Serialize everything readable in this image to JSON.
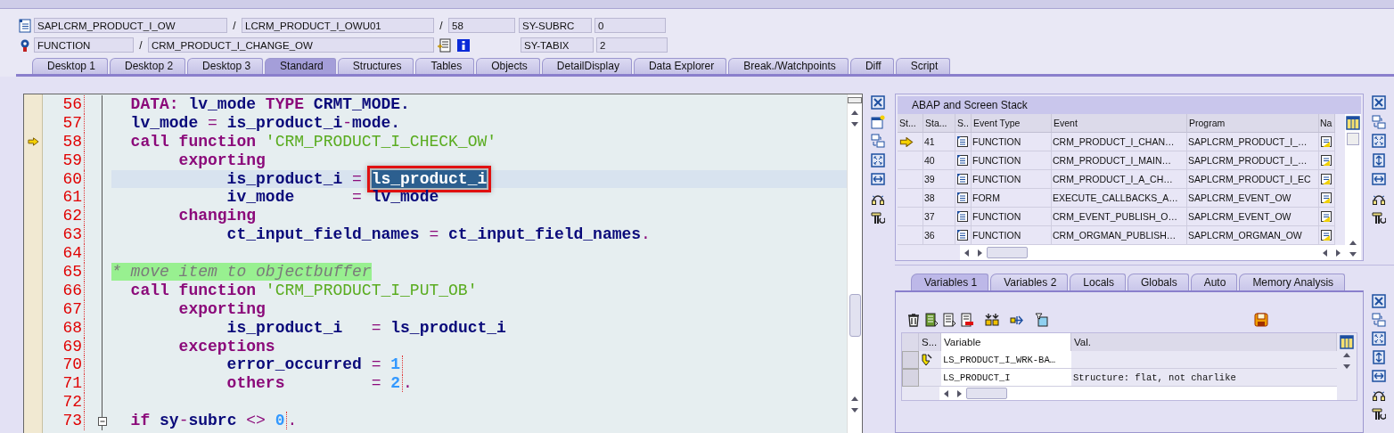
{
  "header": {
    "program": "SAPLCRM_PRODUCT_I_OW",
    "include": "LCRM_PRODUCT_I_OWU01",
    "line": "58",
    "separators": [
      "/",
      "/",
      "/"
    ],
    "event_type": "FUNCTION",
    "event": "CRM_PRODUCT_I_CHANGE_OW",
    "system_fields": [
      {
        "name": "SY-SUBRC",
        "value": "0"
      },
      {
        "name": "SY-TABIX",
        "value": "2"
      }
    ]
  },
  "tabs": [
    {
      "label": "Desktop 1",
      "selected": false
    },
    {
      "label": "Desktop 2",
      "selected": false
    },
    {
      "label": "Desktop 3",
      "selected": false
    },
    {
      "label": "Standard",
      "selected": true
    },
    {
      "label": "Structures",
      "selected": false
    },
    {
      "label": "Tables",
      "selected": false
    },
    {
      "label": "Objects",
      "selected": false
    },
    {
      "label": "DetailDisplay",
      "selected": false
    },
    {
      "label": "Data Explorer",
      "selected": false
    },
    {
      "label": "Break./Watchpoints",
      "selected": false
    },
    {
      "label": "Diff",
      "selected": false
    },
    {
      "label": "Script",
      "selected": false
    }
  ],
  "editor": {
    "lines": [
      {
        "number": "56",
        "current": false,
        "highlighted": false,
        "foldable": false,
        "tokens": [
          {
            "kind": "keyword",
            "text": "  DATA:"
          },
          {
            "kind": "identifier",
            "text": " lv_mode"
          },
          {
            "kind": "keyword",
            "text": " TYPE"
          },
          {
            "kind": "identifier",
            "text": " CRMT_MODE."
          }
        ]
      },
      {
        "number": "57",
        "current": false,
        "highlighted": false,
        "foldable": false,
        "tokens": [
          {
            "kind": "identifier",
            "text": "  lv_mode"
          },
          {
            "kind": "operator",
            "text": " ="
          },
          {
            "kind": "identifier",
            "text": " is_product_i"
          },
          {
            "kind": "operator",
            "text": "-"
          },
          {
            "kind": "identifier",
            "text": "mode."
          }
        ]
      },
      {
        "number": "58",
        "current": true,
        "highlighted": false,
        "foldable": false,
        "tokens": [
          {
            "kind": "keyword",
            "text": "  call function"
          },
          {
            "kind": "string",
            "text": " 'CRM_PRODUCT_I_CHECK_OW'"
          }
        ]
      },
      {
        "number": "59",
        "current": false,
        "highlighted": false,
        "foldable": false,
        "tokens": [
          {
            "kind": "keyword",
            "text": "       exporting"
          }
        ]
      },
      {
        "number": "60",
        "current": false,
        "highlighted": true,
        "foldable": false,
        "tokens": [
          {
            "kind": "identifier",
            "text": "            is_product_i"
          },
          {
            "kind": "operator",
            "text": " = "
          },
          {
            "kind": "selection",
            "text": "ls_product_i"
          }
        ]
      },
      {
        "number": "61",
        "current": false,
        "highlighted": false,
        "foldable": false,
        "tokens": [
          {
            "kind": "identifier",
            "text": "            iv_mode"
          },
          {
            "kind": "operator",
            "text": "      ="
          },
          {
            "kind": "identifier",
            "text": " lv_mode"
          }
        ]
      },
      {
        "number": "62",
        "current": false,
        "highlighted": false,
        "foldable": false,
        "tokens": [
          {
            "kind": "keyword",
            "text": "       changing"
          }
        ]
      },
      {
        "number": "63",
        "current": false,
        "highlighted": false,
        "foldable": false,
        "tokens": [
          {
            "kind": "identifier",
            "text": "            ct_input_field_names"
          },
          {
            "kind": "operator",
            "text": " ="
          },
          {
            "kind": "identifier",
            "text": " ct_input_field_names"
          },
          {
            "kind": "operator",
            "text": "."
          }
        ]
      },
      {
        "number": "64",
        "current": false,
        "highlighted": false,
        "foldable": false
      },
      {
        "number": "65",
        "current": false,
        "highlighted": false,
        "foldable": false,
        "tokens": [
          {
            "kind": "comment",
            "text": "* move item to objectbuffer"
          }
        ]
      },
      {
        "number": "66",
        "current": false,
        "highlighted": false,
        "foldable": false,
        "tokens": [
          {
            "kind": "keyword",
            "text": "  call function"
          },
          {
            "kind": "string",
            "text": " 'CRM_PRODUCT_I_PUT_OB'"
          }
        ]
      },
      {
        "number": "67",
        "current": false,
        "highlighted": false,
        "foldable": false,
        "tokens": [
          {
            "kind": "keyword",
            "text": "       exporting"
          }
        ]
      },
      {
        "number": "68",
        "current": false,
        "highlighted": false,
        "foldable": false,
        "tokens": [
          {
            "kind": "identifier",
            "text": "            is_product_i"
          },
          {
            "kind": "operator",
            "text": "   ="
          },
          {
            "kind": "identifier",
            "text": " ls_product_i"
          }
        ]
      },
      {
        "number": "69",
        "current": false,
        "highlighted": false,
        "foldable": false,
        "tokens": [
          {
            "kind": "keyword",
            "text": "       exceptions"
          }
        ]
      },
      {
        "number": "70",
        "current": false,
        "highlighted": false,
        "foldable": false,
        "tokens": [
          {
            "kind": "identifier",
            "text": "            error_occurred"
          },
          {
            "kind": "operator",
            "text": " ="
          },
          {
            "kind": "number",
            "text": " 1"
          }
        ]
      },
      {
        "number": "71",
        "current": false,
        "highlighted": false,
        "foldable": false,
        "tokens": [
          {
            "kind": "keyword",
            "text": "            others"
          },
          {
            "kind": "operator",
            "text": "         ="
          },
          {
            "kind": "number",
            "text": " 2"
          },
          {
            "kind": "operator",
            "text": "."
          }
        ]
      },
      {
        "number": "72",
        "current": false,
        "highlighted": false,
        "foldable": false
      },
      {
        "number": "73",
        "current": false,
        "highlighted": false,
        "foldable": true,
        "tokens": [
          {
            "kind": "keyword",
            "text": "  if"
          },
          {
            "kind": "identifier",
            "text": " sy"
          },
          {
            "kind": "operator",
            "text": "-"
          },
          {
            "kind": "identifier",
            "text": "subrc"
          },
          {
            "kind": "operator",
            "text": " <>"
          },
          {
            "kind": "number",
            "text": " 0"
          },
          {
            "kind": "operator",
            "text": "."
          }
        ]
      }
    ]
  },
  "stack": {
    "title": "ABAP and Screen Stack",
    "columns": [
      "St...",
      "Sta...",
      "S..",
      "Event Type",
      "Event",
      "Program",
      "Na"
    ],
    "rows": [
      {
        "current": true,
        "stack_level": "41",
        "event_type": "FUNCTION",
        "event": "CRM_PRODUCT_I_CHAN…",
        "program": "SAPLCRM_PRODUCT_I_…"
      },
      {
        "current": false,
        "stack_level": "40",
        "event_type": "FUNCTION",
        "event": "CRM_PRODUCT_I_MAIN…",
        "program": "SAPLCRM_PRODUCT_I_…"
      },
      {
        "current": false,
        "stack_level": "39",
        "event_type": "FUNCTION",
        "event": "CRM_PRODUCT_I_A_CH…",
        "program": "SAPLCRM_PRODUCT_I_EC"
      },
      {
        "current": false,
        "stack_level": "38",
        "event_type": "FORM",
        "event": "EXECUTE_CALLBACKS_A…",
        "program": "SAPLCRM_EVENT_OW"
      },
      {
        "current": false,
        "stack_level": "37",
        "event_type": "FUNCTION",
        "event": "CRM_EVENT_PUBLISH_O…",
        "program": "SAPLCRM_EVENT_OW"
      },
      {
        "current": false,
        "stack_level": "36",
        "event_type": "FUNCTION",
        "event": "CRM_ORGMAN_PUBLISH…",
        "program": "SAPLCRM_ORGMAN_OW"
      }
    ]
  },
  "variables": {
    "tabs": [
      {
        "label": "Variables 1",
        "selected": true
      },
      {
        "label": "Variables 2",
        "selected": false
      },
      {
        "label": "Locals",
        "selected": false
      },
      {
        "label": "Globals",
        "selected": false
      },
      {
        "label": "Auto",
        "selected": false
      },
      {
        "label": "Memory Analysis",
        "selected": false
      }
    ],
    "columns": [
      "S...",
      "Variable",
      "Val."
    ],
    "rows": [
      {
        "changed": true,
        "variable": "LS_PRODUCT_I_WRK-BA…",
        "value": ""
      },
      {
        "changed": false,
        "variable": "LS_PRODUCT_I",
        "value": "Structure: flat, not charlike"
      }
    ]
  }
}
